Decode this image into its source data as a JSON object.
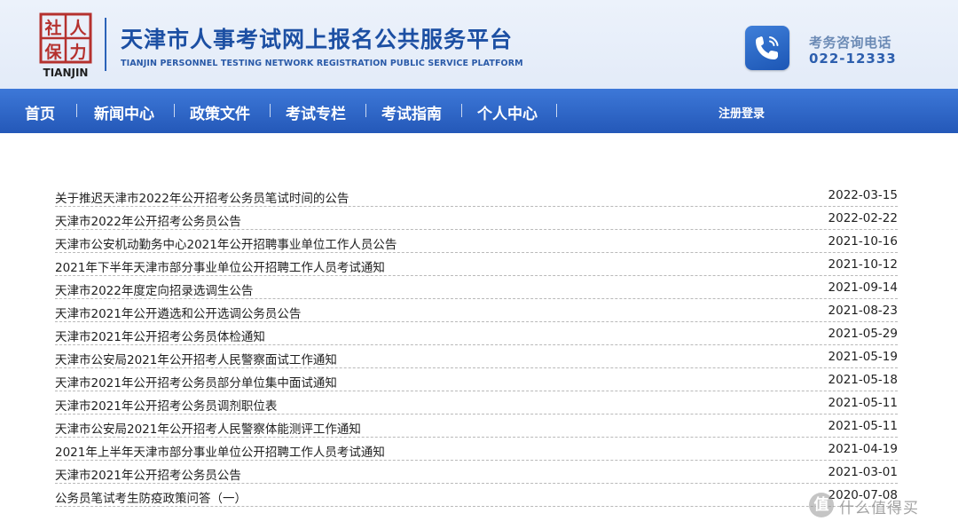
{
  "header": {
    "logo_chars": [
      "社",
      "人",
      "保",
      "力"
    ],
    "logo_caption": "TIANJIN",
    "title": "天津市人事考试网上报名公共服务平台",
    "subtitle": "TIANJIN PERSONNEL TESTING NETWORK REGISTRATION PUBLIC SERVICE PLATFORM",
    "hotline_label": "考务咨询电话",
    "hotline_number": "022-12333",
    "phone_icon": "phone-icon"
  },
  "nav": {
    "items": [
      {
        "label": "首页"
      },
      {
        "label": "新闻中心"
      },
      {
        "label": "政策文件"
      },
      {
        "label": "考试专栏"
      },
      {
        "label": "考试指南"
      },
      {
        "label": "个人中心"
      }
    ],
    "login_label": "注册登录"
  },
  "news": [
    {
      "title": "关于推迟天津市2022年公开招考公务员笔试时间的公告",
      "date": "2022-03-15"
    },
    {
      "title": "天津市2022年公开招考公务员公告",
      "date": "2022-02-22"
    },
    {
      "title": "天津市公安机动勤务中心2021年公开招聘事业单位工作人员公告",
      "date": "2021-10-16"
    },
    {
      "title": "2021年下半年天津市部分事业单位公开招聘工作人员考试通知",
      "date": "2021-10-12"
    },
    {
      "title": "天津市2022年度定向招录选调生公告",
      "date": "2021-09-14"
    },
    {
      "title": "天津市2021年公开遴选和公开选调公务员公告",
      "date": "2021-08-23"
    },
    {
      "title": "天津市2021年公开招考公务员体检通知",
      "date": "2021-05-29"
    },
    {
      "title": "天津市公安局2021年公开招考人民警察面试工作通知",
      "date": "2021-05-19"
    },
    {
      "title": "天津市2021年公开招考公务员部分单位集中面试通知",
      "date": "2021-05-18"
    },
    {
      "title": "天津市2021年公开招考公务员调剂职位表",
      "date": "2021-05-11"
    },
    {
      "title": "天津市公安局2021年公开招考人民警察体能测评工作通知",
      "date": "2021-05-11"
    },
    {
      "title": "2021年上半年天津市部分事业单位公开招聘工作人员考试通知",
      "date": "2021-04-19"
    },
    {
      "title": "天津市2021年公开招考公务员公告",
      "date": "2021-03-01"
    },
    {
      "title": "公务员笔试考生防疫政策问答（一）",
      "date": "2020-07-08"
    }
  ],
  "watermark": {
    "badge": "值",
    "text": "什么值得买"
  },
  "colors": {
    "brand_blue": "#1c4fa3",
    "nav_top": "#3d78d8",
    "nav_bottom": "#2458b8",
    "logo_red": "#b5312e"
  }
}
